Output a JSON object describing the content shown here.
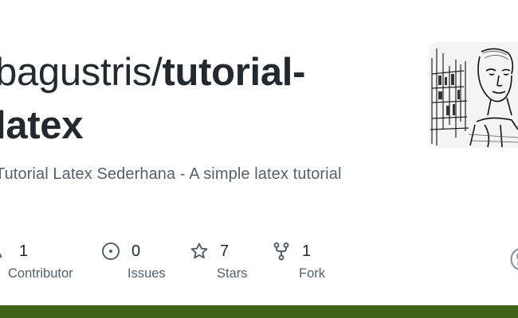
{
  "repo": {
    "owner_prefix": "bagustris/",
    "name_line1": "tutorial-",
    "name_line2": "latex",
    "description": "Tutorial Latex Sederhana - A simple latex tutorial"
  },
  "stats": [
    {
      "icon": "people-icon",
      "count": "1",
      "label": "Contributor"
    },
    {
      "icon": "issue-icon",
      "count": "0",
      "label": "Issues"
    },
    {
      "icon": "star-icon",
      "count": "7",
      "label": "Stars"
    },
    {
      "icon": "fork-icon",
      "count": "1",
      "label": "Fork"
    }
  ],
  "colors": {
    "language_bar": "#3d6117",
    "title_text": "#24292f",
    "muted_text": "#57606a"
  }
}
